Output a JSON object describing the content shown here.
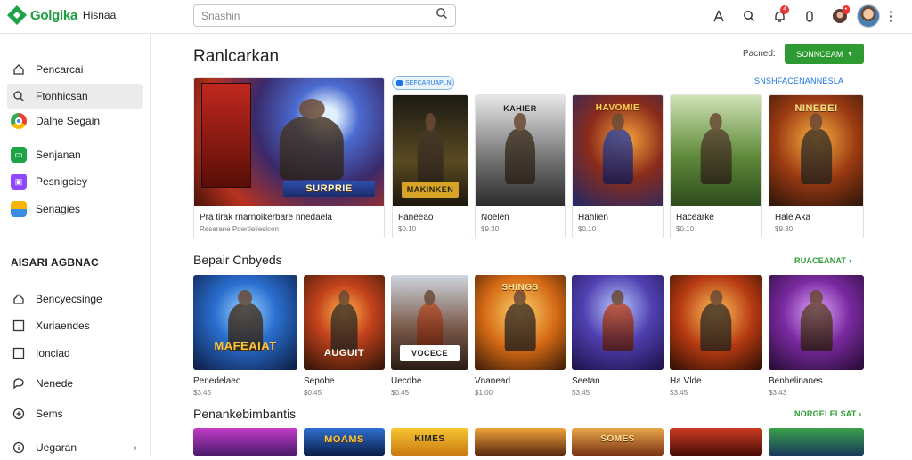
{
  "header": {
    "logo_text": "Golgika",
    "logo_sub": "Hisnaa",
    "search_placeholder": "Snashin",
    "notif_count": "4",
    "icons": [
      "user-icon",
      "search-icon",
      "bell-icon",
      "power-icon",
      "profile-icon",
      "more-icon"
    ]
  },
  "sidebar": {
    "items": [
      {
        "label": "Pencarcai",
        "icon": "home-icon"
      },
      {
        "label": "Ftonhicsan",
        "icon": "search-icon"
      },
      {
        "label": "Dalhe Segain",
        "icon": "chrome-icon"
      },
      {
        "label": "Senjanan",
        "icon": "controller-icon"
      },
      {
        "label": "Pesnigciey",
        "icon": "twitch-icon"
      },
      {
        "label": "Senagies",
        "icon": "folder-icon"
      }
    ],
    "section_title": "AISARI AGBNAC",
    "section_items": [
      {
        "label": "Bencyecsinge",
        "icon": "home-icon"
      },
      {
        "label": "Xuriaendes",
        "icon": "checkbox-icon"
      },
      {
        "label": "Ionciad",
        "icon": "checkbox-icon"
      },
      {
        "label": "Nenede",
        "icon": "chat-icon"
      },
      {
        "label": "Sems",
        "icon": "plus-circle-icon"
      },
      {
        "label": "Uegaran",
        "icon": "info-icon"
      }
    ]
  },
  "main": {
    "title": "Ranlcarkan",
    "filter_label": "Pacned:",
    "filter_button": "SONNCEAM",
    "pill": "SEFCARUAPLN",
    "top_link": "SNSHFACENANNESLA",
    "featured": [
      {
        "title": "Pra tirak rnarnoikerbare nnedaela",
        "meta": "Reserane Pdertlelieslcon"
      },
      {
        "title": "Faneeao",
        "meta": "$0.10"
      },
      {
        "title": "Noelen",
        "meta": "$9.30"
      },
      {
        "title": "Hahlien",
        "meta": "$0.10"
      },
      {
        "title": "Hacearke",
        "meta": "$0.10"
      },
      {
        "title": "Hale Aka",
        "meta": "$9.30"
      }
    ],
    "featured_art_text": [
      "SURPRIE",
      "MAKINKEN",
      "KAHIER",
      "HAVOMIE",
      "",
      "NINEBEI"
    ],
    "row1": {
      "title": "Bepair Cnbyeds",
      "link": "RUACEANAT",
      "items": [
        {
          "label": "Penedelaeo",
          "meta": "$3.45",
          "art": "MAFEAIAT"
        },
        {
          "label": "Sepobe",
          "meta": "$0.45",
          "art": "AUGUIT"
        },
        {
          "label": "Uecdbe",
          "meta": "$0.45",
          "art": "VOCECE"
        },
        {
          "label": "Vnanead",
          "meta": "$1.00",
          "art": "SHINGS"
        },
        {
          "label": "Seetan",
          "meta": "$3.45",
          "art": ""
        },
        {
          "label": "Ha Vlde",
          "meta": "$3.45",
          "art": ""
        },
        {
          "label": "Benhelinanes",
          "meta": "$3.43",
          "art": ""
        }
      ]
    },
    "row2": {
      "title": "Penankebimbantis",
      "link": "NORGELELSAT",
      "items": [
        {
          "art": ""
        },
        {
          "art": "MOAMS"
        },
        {
          "art": "KIMES"
        },
        {
          "art": ""
        },
        {
          "art": "SOMES"
        },
        {
          "art": ""
        },
        {
          "art": ""
        }
      ]
    }
  },
  "colors": {
    "accent_green": "#2e9a32",
    "link_blue": "#1a73e8",
    "badge_red": "#e53935"
  }
}
